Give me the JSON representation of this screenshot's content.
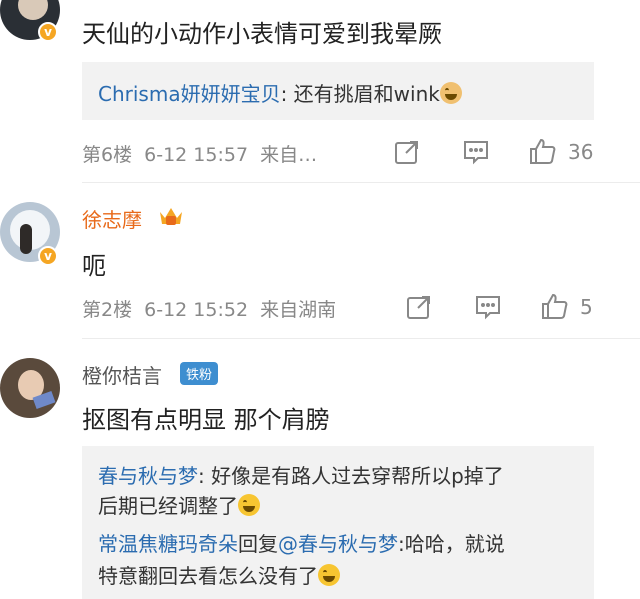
{
  "comments": [
    {
      "text": "天仙的小动作小表情可爱到我晕厥",
      "reply": {
        "user": "Chrisma妍妍妍宝贝",
        "text": ": 还有挑眉和wink"
      },
      "floor": "第6楼",
      "time": "6-12 15:57",
      "source": "来自…",
      "likes": "36"
    },
    {
      "name": "徐志摩",
      "text": "呃",
      "floor": "第2楼",
      "time": "6-12 15:52",
      "source": "来自湖南",
      "likes": "5"
    },
    {
      "name": "橙你桔言",
      "badge": "铁粉",
      "text": "抠图有点明显 那个肩膀",
      "replies": [
        {
          "user": "春与秋与梦",
          "line1": ": 好像是有路人过去穿帮所以p掉了",
          "line2": "后期已经调整了"
        },
        {
          "user": "常温焦糖玛奇朵",
          "mid": "回复",
          "mention": "@春与秋与梦",
          "line1": ":哈哈，就说",
          "line2": "特意翻回去看怎么没有了"
        }
      ]
    }
  ],
  "colors": {
    "link": "#2b6cb0",
    "name_orange": "#e86a1a",
    "meta": "#888888",
    "reply_bg": "#f2f2f2"
  },
  "icons": [
    "verified-icon",
    "share-icon",
    "comment-icon",
    "like-icon",
    "crown-icon",
    "emoji-icon"
  ]
}
